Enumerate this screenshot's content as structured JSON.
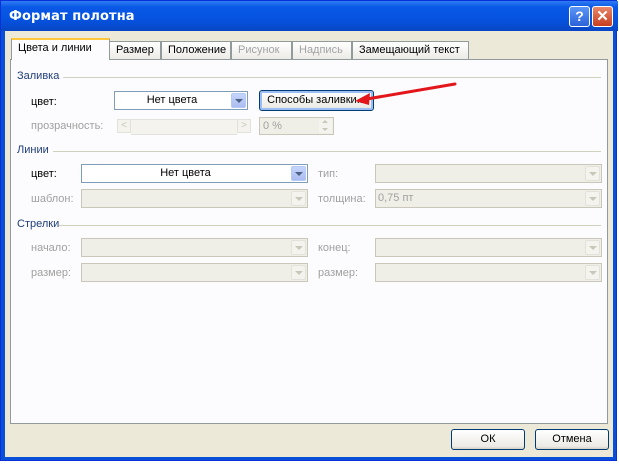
{
  "window": {
    "title": "Формат полотна",
    "help_glyph": "?",
    "close_glyph": "✕"
  },
  "tabs": [
    {
      "label": "Цвета и линии",
      "active": true,
      "enabled": true
    },
    {
      "label": "Размер",
      "active": false,
      "enabled": true
    },
    {
      "label": "Положение",
      "active": false,
      "enabled": true
    },
    {
      "label": "Рисунок",
      "active": false,
      "enabled": false
    },
    {
      "label": "Надпись",
      "active": false,
      "enabled": false
    },
    {
      "label": "Замещающий текст",
      "active": false,
      "enabled": true
    }
  ],
  "fill": {
    "section_title": "Заливка",
    "color_label": "цвет:",
    "color_value": "Нет цвета",
    "fill_effects_button": "Способы заливки...",
    "transparency_label": "прозрачность:",
    "transparency_value": "0 %",
    "slider_left": "<",
    "slider_right": ">"
  },
  "lines": {
    "section_title": "Линии",
    "color_label": "цвет:",
    "color_value": "Нет цвета",
    "dash_label": "шаблон:",
    "type_label": "тип:",
    "weight_label": "толщина:",
    "weight_value": "0,75 пт"
  },
  "arrows": {
    "section_title": "Стрелки",
    "begin_style_label": "начало:",
    "begin_size_label": "размер:",
    "end_style_label": "конец:",
    "end_size_label": "размер:"
  },
  "footer": {
    "ok": "ОК",
    "cancel": "Отмена"
  },
  "colors": {
    "title_bar": "#0a59e6",
    "dialog_bg": "#ece9d8",
    "annotation_arrow": "#e3161b"
  }
}
